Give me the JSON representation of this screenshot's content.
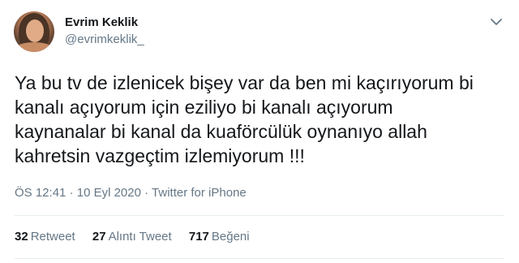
{
  "user": {
    "display_name": "Evrim Keklik",
    "handle": "@evrimkeklik_",
    "avatar_icon": "profile-photo"
  },
  "tweet": {
    "lines": [
      "Ya bu tv de izlenicek bişey var da ben mi kaçırıyorum bi",
      "kanalı açıyorum için eziliyo bi kanalı açıyorum",
      "kaynanalar bi kanal da kuaförcülük oynanıyo allah",
      "kahretsin vazgeçtim izlemiyorum !!!"
    ]
  },
  "meta": {
    "time": "ÖS 12:41",
    "separator": "·",
    "date": "10 Eyl 2020",
    "source": "Twitter for iPhone"
  },
  "stats": {
    "retweets": {
      "count": "32",
      "label": "Retweet"
    },
    "quotes": {
      "count": "27",
      "label": "Alıntı Tweet"
    },
    "likes": {
      "count": "717",
      "label": "Beğeni"
    }
  },
  "colors": {
    "text": "#14171a",
    "secondary": "#657786",
    "divider": "#e6ecf0"
  }
}
